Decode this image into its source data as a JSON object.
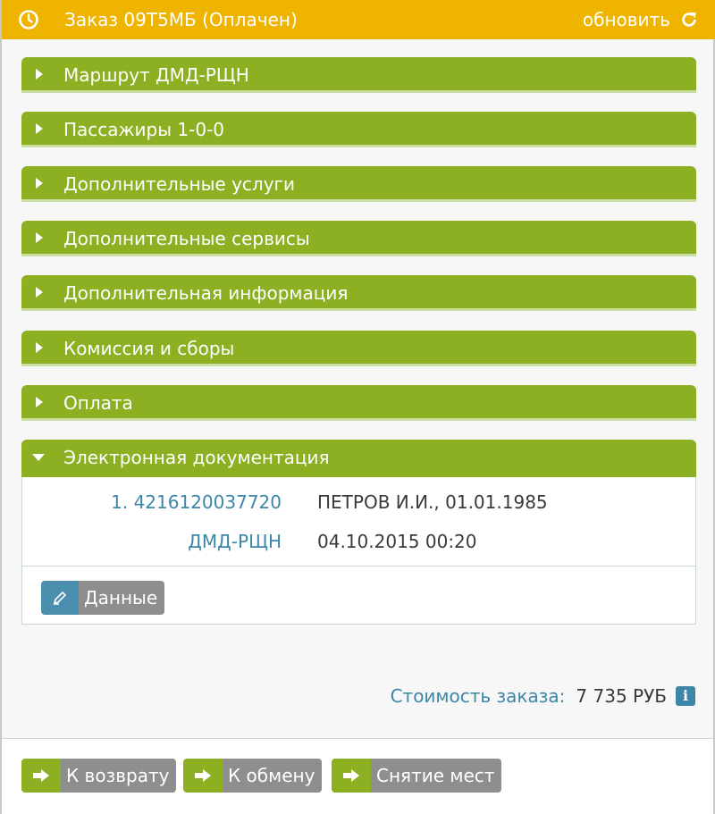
{
  "header": {
    "title": "Заказ 09Т5МБ (Оплачен)",
    "refresh_label": "обновить"
  },
  "sections": [
    {
      "label": "Маршрут ДМД-РЩН",
      "expanded": false
    },
    {
      "label": "Пассажиры 1-0-0",
      "expanded": false
    },
    {
      "label": "Дополнительные услуги",
      "expanded": false
    },
    {
      "label": "Дополнительные сервисы",
      "expanded": false
    },
    {
      "label": "Дополнительная информация",
      "expanded": false
    },
    {
      "label": "Комиссия и сборы",
      "expanded": false
    },
    {
      "label": "Оплата",
      "expanded": false
    },
    {
      "label": "Электронная документация",
      "expanded": true
    }
  ],
  "documents": {
    "ticket_link": "1. 4216120037720",
    "passenger": "ПЕТРОВ И.И., 01.01.1985",
    "route_link": "ДМД-РЩН",
    "datetime": "04.10.2015 00:20",
    "data_button": "Данные"
  },
  "cost": {
    "label": "Стоимость заказа:",
    "value": "7 735 РУБ"
  },
  "footer": {
    "return_label": "К возврату",
    "exchange_label": "К обмену",
    "release_label": "Снятие мест"
  }
}
